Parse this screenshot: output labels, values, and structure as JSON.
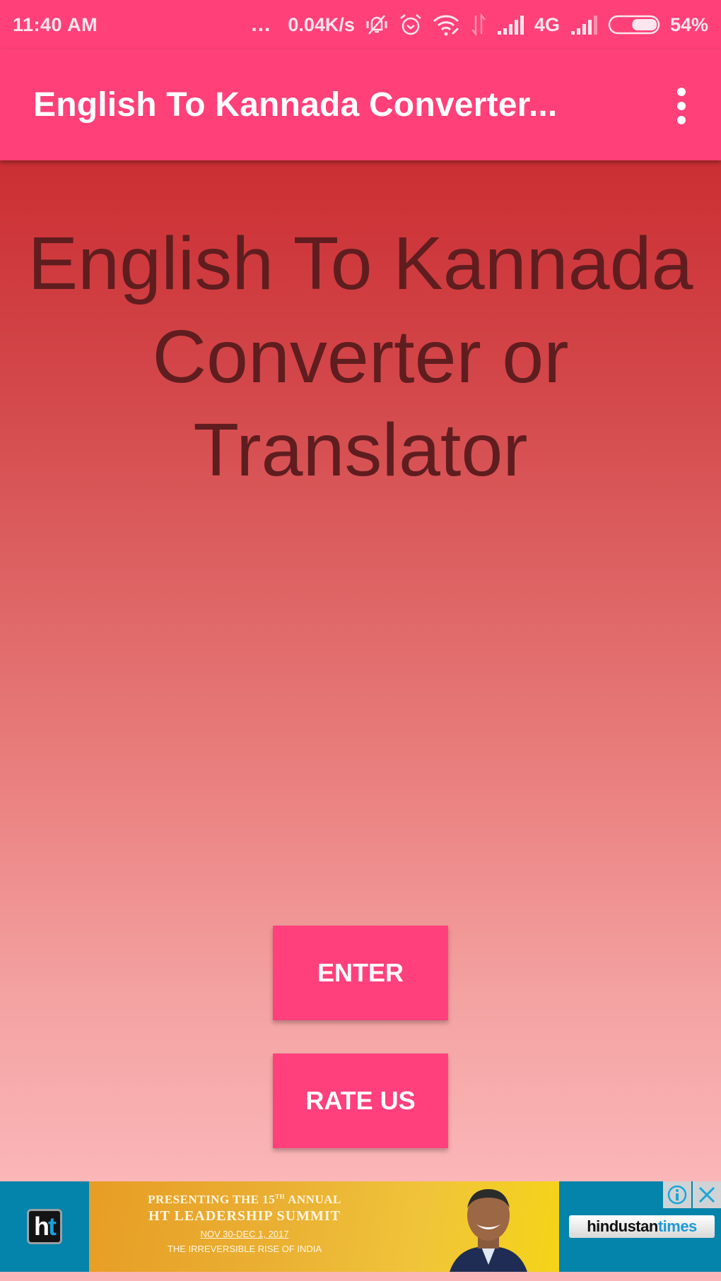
{
  "status_bar": {
    "time": "11:40 AM",
    "more_indicator": "...",
    "network_speed": "0.04K/s",
    "icons": [
      "vibrate-muted-icon",
      "alarm-icon",
      "wifi-icon",
      "data-transfer-icon",
      "signal-sim1-icon",
      "signal-sim2-icon",
      "battery-icon"
    ],
    "network_type": "4G",
    "battery_level_percent": 54,
    "battery_text": "54%"
  },
  "app_bar": {
    "title": "English To Kannada Converter...",
    "overflow_icon": "more-vert-icon"
  },
  "main": {
    "headline_lines": [
      "English To Kannada",
      "Converter or",
      "Translator"
    ],
    "buttons": {
      "enter_label": "ENTER",
      "rate_label": "RATE US"
    }
  },
  "ad": {
    "brand_short": "ht",
    "line1": "PRESENTING THE 15TH ANNUAL",
    "line1_pre": "PRESENTING THE 15",
    "line1_sup": "TH",
    "line1_post": " ANNUAL",
    "line2": "HT LEADERSHIP SUMMIT",
    "line3": "NOV 30-DEC 1, 2017",
    "line4": "THE IRREVERSIBLE RISE OF INDIA",
    "brand_logo_part1": "hindustan",
    "brand_logo_part2": "times",
    "info_icon": "info-icon",
    "close_icon": "close-icon"
  },
  "colors": {
    "accent": "#ff4079",
    "headline_text": "#5f1d1f",
    "gradient_top": "#cb2f33",
    "gradient_bottom": "#fbb6b8",
    "ad_blue": "#0483ab"
  }
}
